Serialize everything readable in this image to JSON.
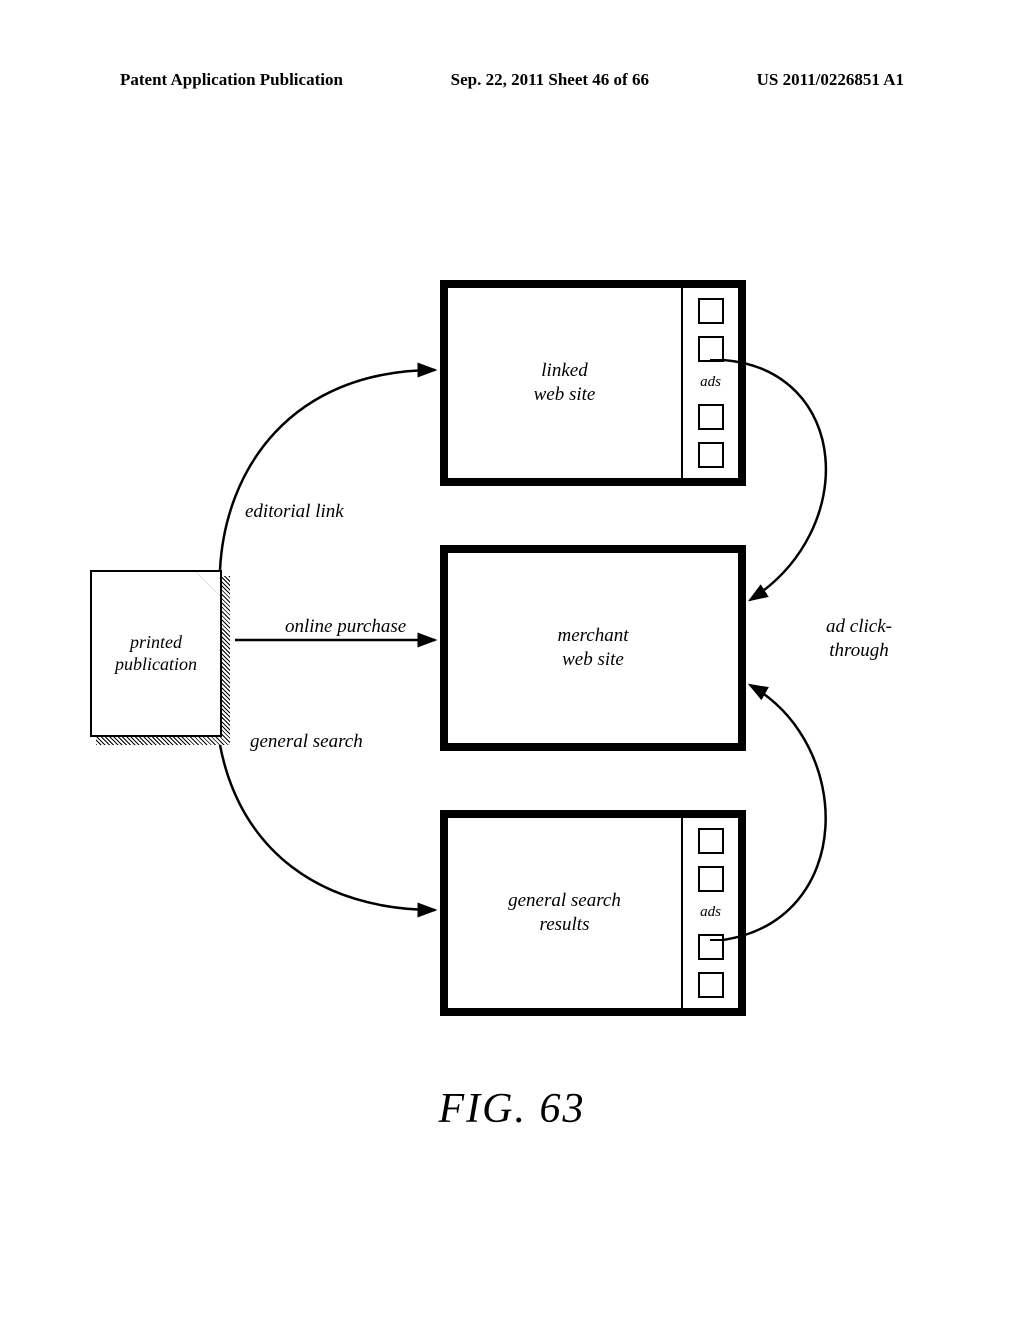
{
  "header": {
    "left": "Patent Application Publication",
    "center": "Sep. 22, 2011  Sheet 46 of 66",
    "right": "US 2011/0226851 A1"
  },
  "labels": {
    "doc": "printed\npublication",
    "editorial": "editorial\nlink",
    "purchase": "online\npurchase",
    "search": "general\nsearch",
    "clickthrough": "ad\nclick-through"
  },
  "boxes": {
    "linked": "linked\nweb site",
    "merchant": "merchant\nweb site",
    "results": "general search\nresults",
    "ads_label": "ads"
  },
  "figure": "FIG. 63"
}
